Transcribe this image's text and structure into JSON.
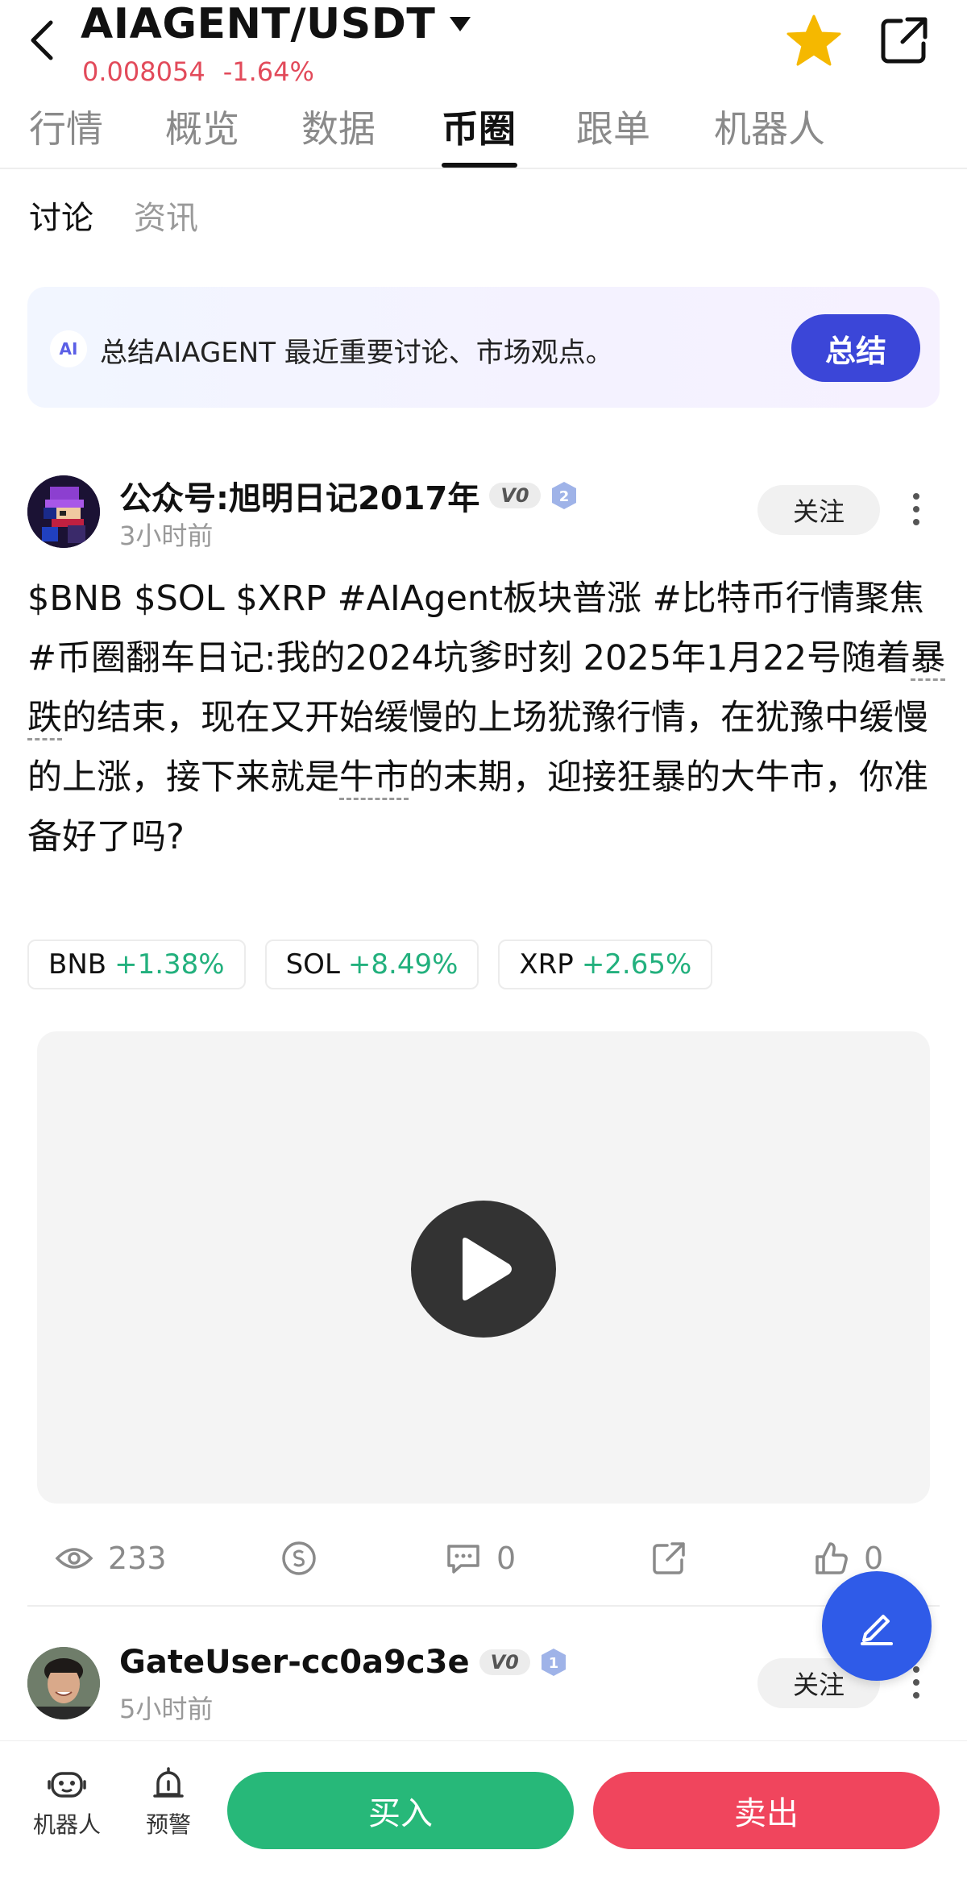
{
  "header": {
    "pair": "AIAGENT/USDT",
    "price": "0.008054",
    "change": "-1.64%"
  },
  "tabs": [
    {
      "label": "行情",
      "active": false
    },
    {
      "label": "概览",
      "active": false
    },
    {
      "label": "数据",
      "active": false
    },
    {
      "label": "币圈",
      "active": true
    },
    {
      "label": "跟单",
      "active": false
    },
    {
      "label": "机器人",
      "active": false
    }
  ],
  "subtabs": [
    {
      "label": "讨论",
      "active": true
    },
    {
      "label": "资讯",
      "active": false
    }
  ],
  "ai_summary": {
    "badge": "AI",
    "text": "总结AIAGENT 最近重要讨论、市场观点。",
    "button": "总结"
  },
  "post1": {
    "author": "公众号:旭明日记2017年",
    "badge": "V0",
    "level": "2",
    "time": "3小时前",
    "follow": "关注",
    "body_part1": "$BNB $SOL $XRP #AIAgent板块普涨 #比特币行情聚焦 #币圈翻车日记:我的2024坑爹时刻 2025年1月22号随着",
    "body_link1": "暴跌",
    "body_part2": "的结束，现在又开始缓慢的上场犹豫行情，在犹豫中缓慢的上涨，接下来就是",
    "body_link2": "牛市",
    "body_part3": "的末期，迎接狂暴的大牛市，你准备好了吗?",
    "coins": [
      {
        "symbol": "BNB",
        "change": "+1.38%"
      },
      {
        "symbol": "SOL",
        "change": "+8.49%"
      },
      {
        "symbol": "XRP",
        "change": "+2.65%"
      }
    ],
    "views": "233",
    "comments": "0",
    "likes": "0"
  },
  "post2": {
    "author": "GateUser-cc0a9c3e",
    "badge": "V0",
    "level": "1",
    "time": "5小时前",
    "follow": "关注"
  },
  "bottom": {
    "robot_label": "机器人",
    "alert_label": "预警",
    "buy": "买入",
    "sell": "卖出"
  },
  "colors": {
    "down": "#e24a5a",
    "up": "#22b07d",
    "buy": "#27b879",
    "sell": "#f0455d",
    "accent": "#3b46d8",
    "star": "#f5b800"
  },
  "icons": [
    "back-arrow-icon",
    "caret-down-icon",
    "star-icon",
    "share-icon",
    "eye-icon",
    "tip-coin-icon",
    "comment-icon",
    "repost-icon",
    "thumbs-up-icon",
    "more-icon",
    "edit-icon",
    "robot-icon",
    "alarm-icon",
    "play-icon"
  ]
}
